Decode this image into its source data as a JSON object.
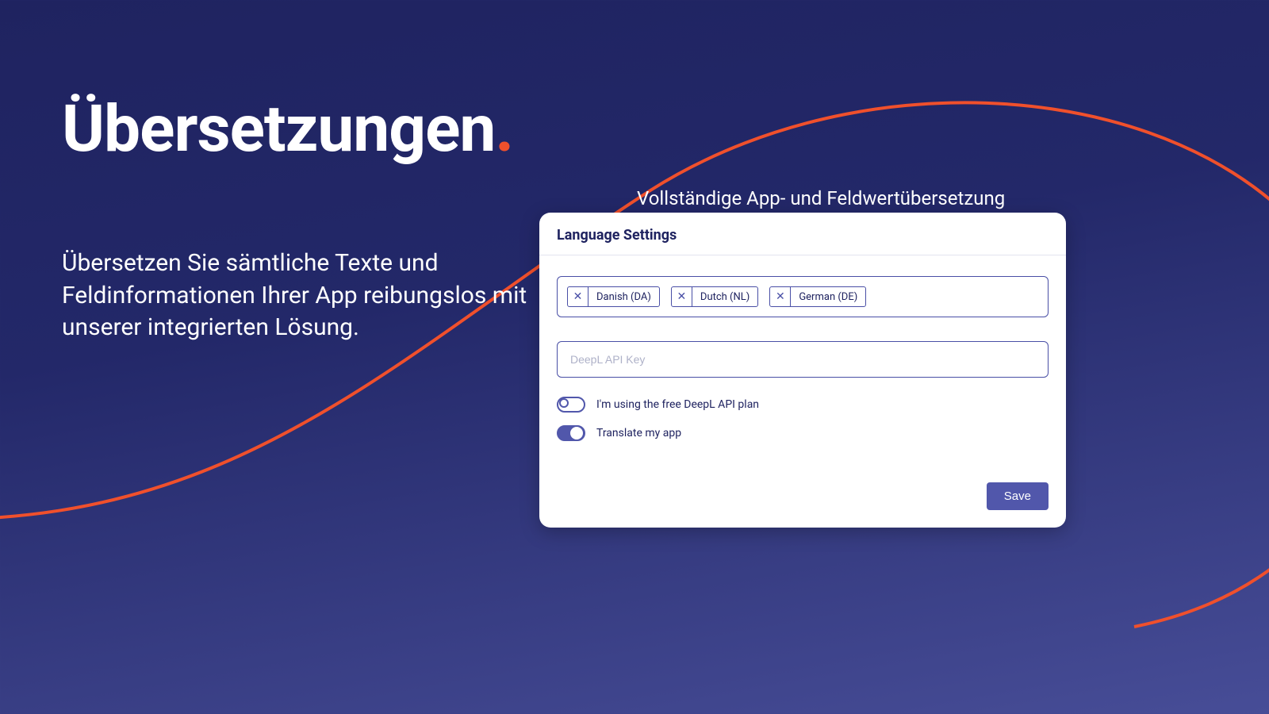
{
  "hero": {
    "headline": "Übersetzungen",
    "dot": ".",
    "sub": "Übersetzen Sie sämtliche Texte und Feldinformationen Ihrer App reibungslos mit unserer integrierten Lösung."
  },
  "panel_caption": "Vollständige App- und Feldwertübersetzung",
  "panel": {
    "title": "Language Settings",
    "languages": [
      "Danish (DA)",
      "Dutch (NL)",
      "German (DE)"
    ],
    "api_key_placeholder": "DeepL API Key",
    "toggle_free_label": "I'm using the free DeepL API plan",
    "toggle_free_on": false,
    "toggle_translate_label": "Translate my app",
    "toggle_translate_on": true,
    "save_label": "Save"
  },
  "colors": {
    "accent": "#f0502c",
    "primary": "#5157ab",
    "bg_dark": "#1f2360"
  }
}
